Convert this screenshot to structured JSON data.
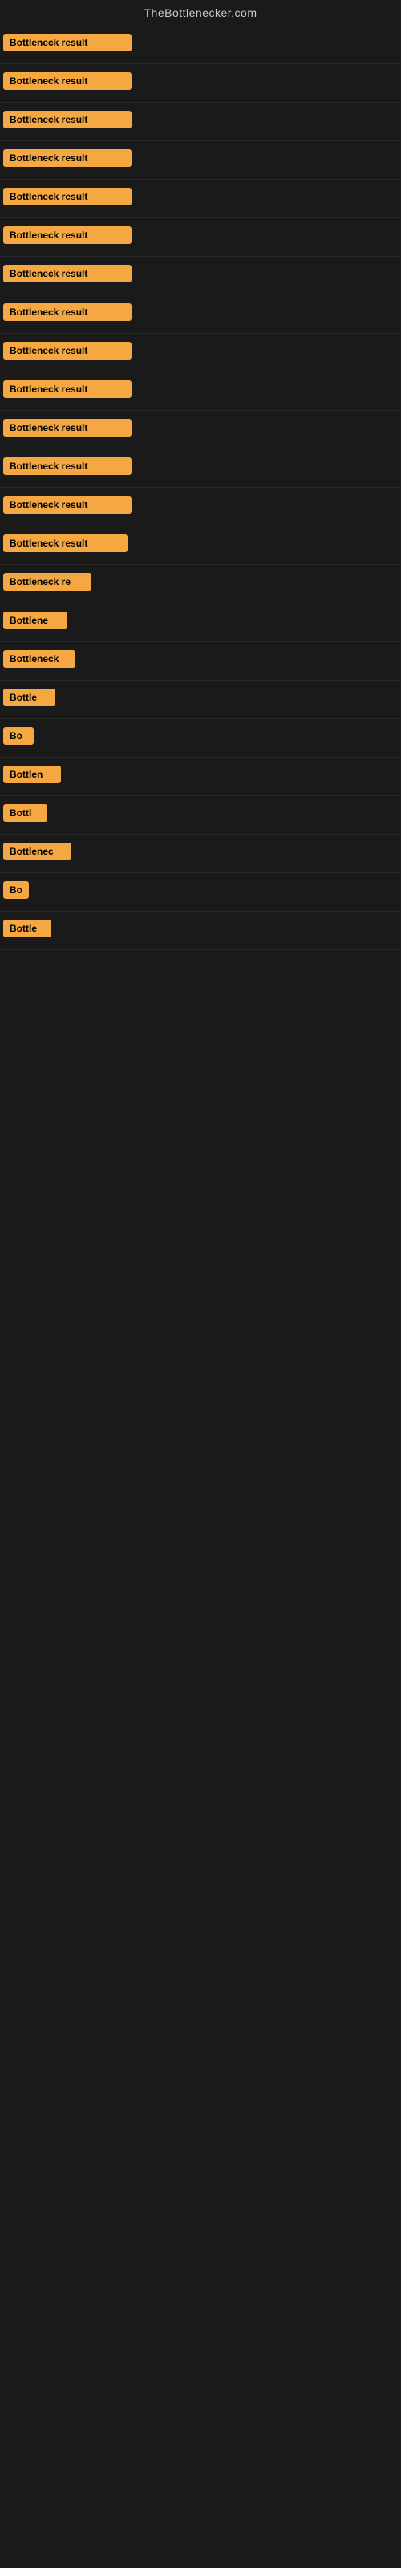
{
  "site": {
    "title": "TheBottlenecker.com"
  },
  "rows": [
    {
      "id": 1,
      "label": "Bottleneck result",
      "width": 160
    },
    {
      "id": 2,
      "label": "Bottleneck result",
      "width": 160
    },
    {
      "id": 3,
      "label": "Bottleneck result",
      "width": 160
    },
    {
      "id": 4,
      "label": "Bottleneck result",
      "width": 160
    },
    {
      "id": 5,
      "label": "Bottleneck result",
      "width": 160
    },
    {
      "id": 6,
      "label": "Bottleneck result",
      "width": 160
    },
    {
      "id": 7,
      "label": "Bottleneck result",
      "width": 160
    },
    {
      "id": 8,
      "label": "Bottleneck result",
      "width": 160
    },
    {
      "id": 9,
      "label": "Bottleneck result",
      "width": 160
    },
    {
      "id": 10,
      "label": "Bottleneck result",
      "width": 160
    },
    {
      "id": 11,
      "label": "Bottleneck result",
      "width": 160
    },
    {
      "id": 12,
      "label": "Bottleneck result",
      "width": 160
    },
    {
      "id": 13,
      "label": "Bottleneck result",
      "width": 160
    },
    {
      "id": 14,
      "label": "Bottleneck result",
      "width": 155
    },
    {
      "id": 15,
      "label": "Bottleneck re",
      "width": 110
    },
    {
      "id": 16,
      "label": "Bottlene",
      "width": 80
    },
    {
      "id": 17,
      "label": "Bottleneck",
      "width": 90
    },
    {
      "id": 18,
      "label": "Bottle",
      "width": 65
    },
    {
      "id": 19,
      "label": "Bo",
      "width": 38
    },
    {
      "id": 20,
      "label": "Bottlen",
      "width": 72
    },
    {
      "id": 21,
      "label": "Bottl",
      "width": 55
    },
    {
      "id": 22,
      "label": "Bottlenec",
      "width": 85
    },
    {
      "id": 23,
      "label": "Bo",
      "width": 32
    },
    {
      "id": 24,
      "label": "Bottle",
      "width": 60
    }
  ],
  "colors": {
    "badge_bg": "#f5a742",
    "badge_text": "#000000",
    "background": "#1a1a1a",
    "title_color": "#cccccc"
  }
}
